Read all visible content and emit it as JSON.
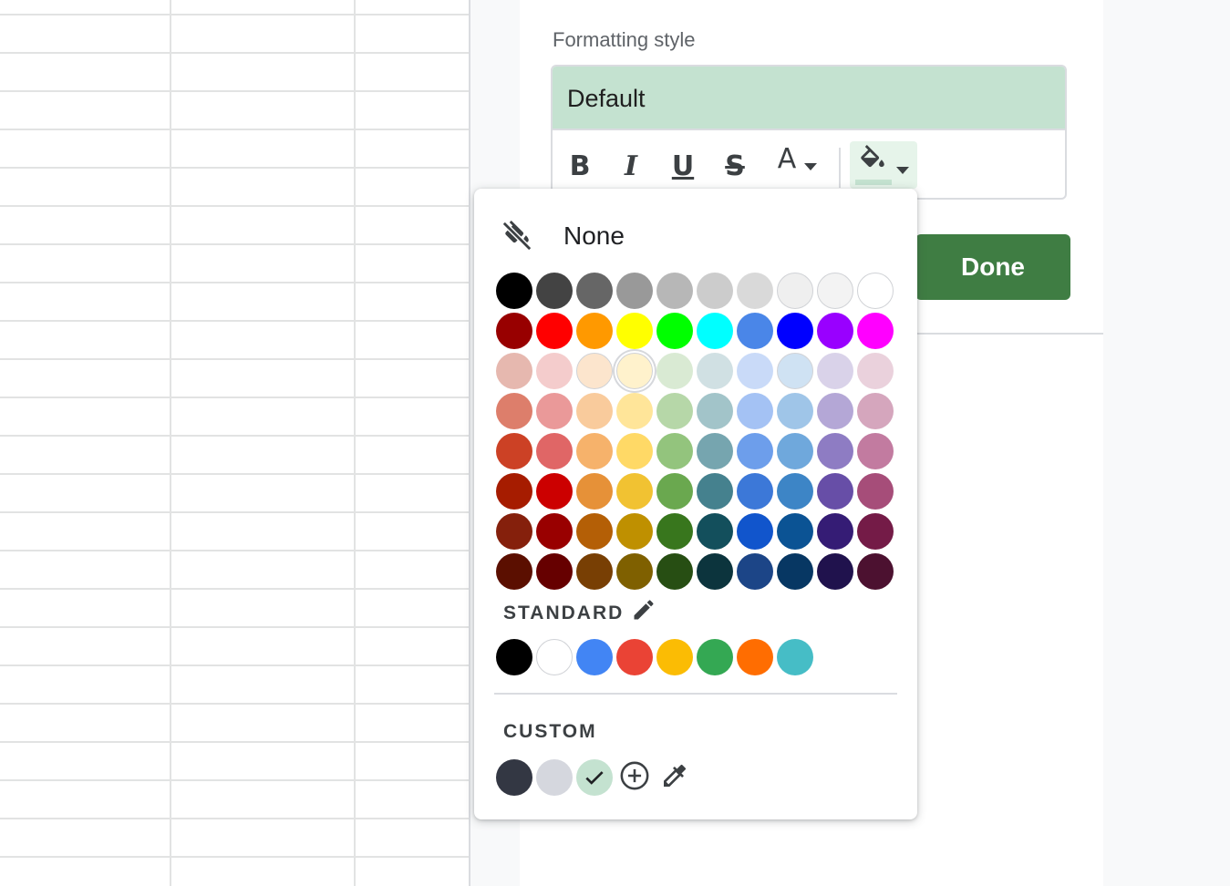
{
  "panel": {
    "formatting_style_label": "Formatting style",
    "preview_text": "Default",
    "preview_bg": "#c4e2d0",
    "done_label": "Done",
    "done_color": "#3f7d43",
    "toolbar": {
      "bold_glyph": "B",
      "italic_glyph": "I",
      "underline_glyph": "U",
      "strike_glyph": "S",
      "text_color_glyph": "A"
    }
  },
  "fill_popup": {
    "none_label": "None",
    "palette": [
      [
        "#000000",
        "#434343",
        "#666666",
        "#999999",
        "#b7b7b7",
        "#cccccc",
        "#d9d9d9",
        "#efefef",
        "#f3f3f3",
        "#ffffff"
      ],
      [
        "#980000",
        "#ff0000",
        "#ff9900",
        "#ffff00",
        "#00ff00",
        "#00ffff",
        "#4a86e8",
        "#0000ff",
        "#9900ff",
        "#ff00ff"
      ],
      [
        "#e6b8af",
        "#f4cccc",
        "#fce5cd",
        "#fff2cc",
        "#d9ead3",
        "#d0e0e3",
        "#c9daf8",
        "#cfe2f3",
        "#d9d2e9",
        "#ead1dc"
      ],
      [
        "#dd7e6b",
        "#ea9999",
        "#f9cb9c",
        "#ffe599",
        "#b6d7a8",
        "#a2c4c9",
        "#a4c2f4",
        "#9fc5e8",
        "#b4a7d6",
        "#d5a6bd"
      ],
      [
        "#cc4125",
        "#e06666",
        "#f6b26b",
        "#ffd966",
        "#93c47d",
        "#76a5af",
        "#6d9eeb",
        "#6fa8dc",
        "#8e7cc3",
        "#c27ba0"
      ],
      [
        "#a61c00",
        "#cc0000",
        "#e69138",
        "#f1c232",
        "#6aa84f",
        "#45818e",
        "#3c78d8",
        "#3d85c6",
        "#674ea7",
        "#a64d79"
      ],
      [
        "#85200c",
        "#990000",
        "#b45f06",
        "#bf9000",
        "#38761d",
        "#134f5c",
        "#1155cc",
        "#0b5394",
        "#351c75",
        "#741b47"
      ],
      [
        "#5b0f00",
        "#660000",
        "#783f04",
        "#7f6000",
        "#274e13",
        "#0c343d",
        "#1c4587",
        "#073763",
        "#20124d",
        "#4c1130"
      ]
    ],
    "standard_label": "STANDARD",
    "standard": [
      "#000000",
      "#ffffff",
      "#4285f4",
      "#ea4335",
      "#fbbc04",
      "#34a853",
      "#ff6d01",
      "#46bdc6"
    ],
    "custom_label": "CUSTOM",
    "custom": [
      "#333743",
      "#d5d7de",
      "#c4e2d0"
    ],
    "custom_selected_index": 2,
    "palette_focused": [
      2,
      3
    ]
  }
}
